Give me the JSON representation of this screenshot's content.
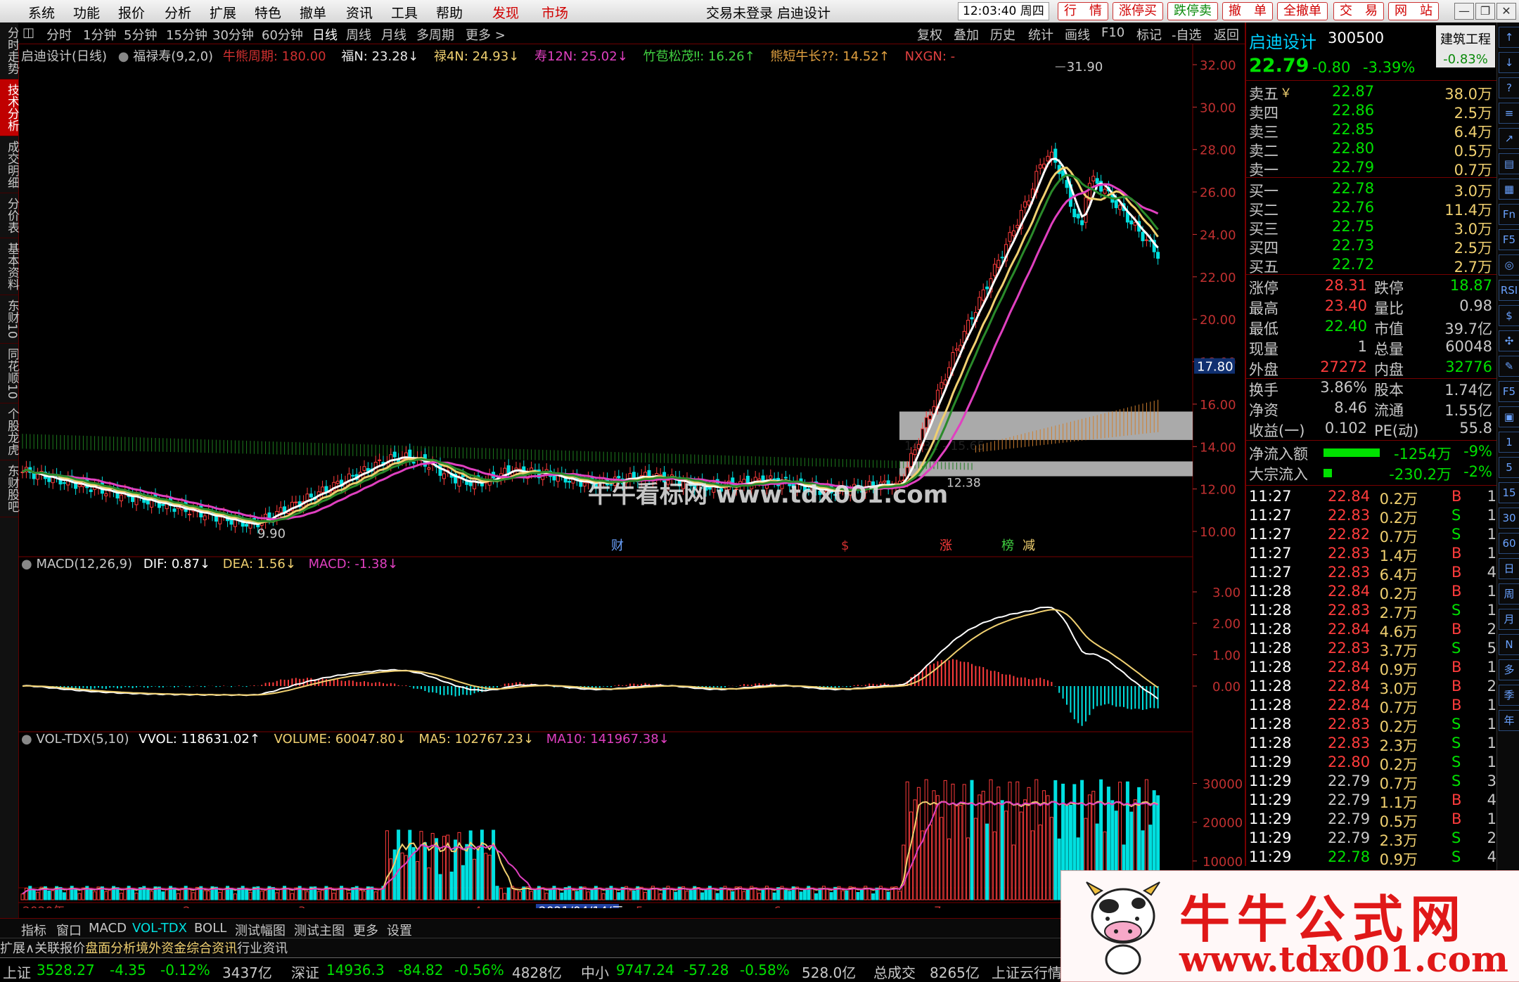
{
  "menubar": {
    "items": [
      "系统",
      "功能",
      "报价",
      "分析",
      "扩展",
      "特色",
      "撤单",
      "资讯",
      "工具",
      "帮助"
    ],
    "tabs": [
      "发现",
      "市场"
    ],
    "title": "交易未登录  启迪设计",
    "time": "12:03:40 周四",
    "pills": [
      "行　情",
      "涨停买",
      "跌停卖",
      "撤　单",
      "全撤单",
      "交　易",
      "网　站"
    ]
  },
  "left_tabs": [
    "分时走势",
    "技术分析",
    "成交明细",
    "分价表",
    "基本资料",
    "东财10",
    "同花顺10",
    "个股龙虎",
    "东财股吧"
  ],
  "toolbar": {
    "periods": [
      "分时",
      "1分钟",
      "5分钟",
      "15分钟",
      "30分钟",
      "60分钟",
      "日线",
      "周线",
      "月线",
      "多周期",
      "更多 >"
    ],
    "active_period": "日线",
    "right": [
      "复权",
      "叠加",
      "历史",
      "统计",
      "画线",
      "F10",
      "标记",
      "-自选",
      "返回"
    ]
  },
  "main_legend": {
    "name": "启迪设计(日线)",
    "indicator": "福禄寿(9,2,0)",
    "cycle": "牛熊周期: 180.00",
    "fu": "福N: 23.28↓",
    "lu": "禄4N: 24.93↓",
    "shou": "寿12N: 25.02↓",
    "zhu": "竹苞松茂‼: 16.26↑",
    "xiong": "熊短牛长??: 14.52↑",
    "nxgn": "NXGN: -"
  },
  "price_axis": [
    "32.00",
    "30.00",
    "28.00",
    "26.00",
    "24.00",
    "22.00",
    "20.00",
    "18.00",
    "16.00",
    "14.00",
    "12.00",
    "10.00"
  ],
  "price_marker": "17.80",
  "annotations": {
    "high": "31.90",
    "low": "9.90",
    "band": "14.31 - 15.65",
    "band2": "12.38"
  },
  "events": [
    "财",
    "$",
    "涨",
    "榜",
    "减"
  ],
  "macd_legend": {
    "name": "MACD(12,26,9)",
    "dif": "DIF: 0.87↓",
    "dea": "DEA: 1.56↓",
    "macd": "MACD: -1.38↓"
  },
  "macd_axis": [
    "3.00",
    "2.00",
    "1.00",
    "0.00"
  ],
  "vol_legend": {
    "name": "VOL-TDX(5,10)",
    "vvol": "VVOL: 118631.02↑",
    "volume": "VOLUME: 60047.80↓",
    "ma5": "MA5: 102767.23↓",
    "ma10": "MA10: 141967.38↓"
  },
  "vol_axis": [
    "30000",
    "20000",
    "10000"
  ],
  "date_axis": [
    "2020年",
    "2",
    "3",
    "4",
    "2021/04/14/三",
    "5",
    "6",
    "7"
  ],
  "watermark": "牛牛看标网 www.tdx001.com",
  "quote": {
    "name": "启迪设计",
    "code": "300500",
    "industry": "建筑工程",
    "price": "22.79",
    "change": "-0.80",
    "pct": "-3.39%",
    "industry_pct": "-0.83%",
    "asks": [
      {
        "label": "卖五",
        "sym": "￥",
        "price": "22.87",
        "vol": "38.0万"
      },
      {
        "label": "卖四",
        "sym": "",
        "price": "22.86",
        "vol": "2.5万"
      },
      {
        "label": "卖三",
        "sym": "",
        "price": "22.85",
        "vol": "6.4万"
      },
      {
        "label": "卖二",
        "sym": "",
        "price": "22.80",
        "vol": "0.5万"
      },
      {
        "label": "卖一",
        "sym": "",
        "price": "22.79",
        "vol": "0.7万"
      }
    ],
    "bids": [
      {
        "label": "买一",
        "price": "22.78",
        "vol": "3.0万"
      },
      {
        "label": "买二",
        "price": "22.76",
        "vol": "11.4万"
      },
      {
        "label": "买三",
        "price": "22.75",
        "vol": "3.0万"
      },
      {
        "label": "买四",
        "price": "22.73",
        "vol": "2.5万"
      },
      {
        "label": "买五",
        "price": "22.72",
        "vol": "2.7万"
      }
    ],
    "stats": [
      {
        "l1": "涨停",
        "v1": "28.31",
        "l2": "跌停",
        "v2": "18.87"
      },
      {
        "l1": "最高",
        "v1": "23.40",
        "l2": "量比",
        "v2": "0.98"
      },
      {
        "l1": "最低",
        "v1": "22.40",
        "l2": "市值",
        "v2": "39.7亿"
      },
      {
        "l1": "现量",
        "v1": "1",
        "l2": "总量",
        "v2": "60048"
      },
      {
        "l1": "外盘",
        "v1": "27272",
        "l2": "内盘",
        "v2": "32776"
      },
      {
        "l1": "换手",
        "v1": "3.86%",
        "l2": "股本",
        "v2": "1.74亿"
      },
      {
        "l1": "净资",
        "v1": "8.46",
        "l2": "流通",
        "v2": "1.55亿"
      },
      {
        "l1": "收益(一)",
        "v1": "0.102",
        "l2": "PE(动)",
        "v2": "55.8"
      }
    ],
    "flows": [
      {
        "label": "净流入额",
        "value": "-1254万",
        "pct": "-9%"
      },
      {
        "label": "大宗流入",
        "value": "-230.2万",
        "pct": "-2%"
      }
    ],
    "ticks": [
      [
        "11:27",
        "22.84",
        "0.2万",
        "B",
        "1"
      ],
      [
        "11:27",
        "22.83",
        "0.2万",
        "S",
        "1"
      ],
      [
        "11:27",
        "22.82",
        "0.7万",
        "S",
        "1"
      ],
      [
        "11:27",
        "22.83",
        "1.4万",
        "B",
        "1"
      ],
      [
        "11:27",
        "22.83",
        "6.4万",
        "B",
        "4"
      ],
      [
        "11:28",
        "22.84",
        "0.2万",
        "B",
        "1"
      ],
      [
        "11:28",
        "22.83",
        "2.7万",
        "S",
        "1"
      ],
      [
        "11:28",
        "22.84",
        "4.6万",
        "B",
        "2"
      ],
      [
        "11:28",
        "22.83",
        "3.7万",
        "S",
        "5"
      ],
      [
        "11:28",
        "22.84",
        "0.9万",
        "B",
        "1"
      ],
      [
        "11:28",
        "22.84",
        "3.0万",
        "B",
        "2"
      ],
      [
        "11:28",
        "22.84",
        "0.7万",
        "B",
        "1"
      ],
      [
        "11:28",
        "22.83",
        "0.2万",
        "S",
        "1"
      ],
      [
        "11:28",
        "22.83",
        "2.3万",
        "S",
        "1"
      ],
      [
        "11:29",
        "22.80",
        "0.2万",
        "S",
        "1"
      ],
      [
        "11:29",
        "22.79",
        "0.7万",
        "S",
        "3"
      ],
      [
        "11:29",
        "22.79",
        "1.1万",
        "B",
        "4"
      ],
      [
        "11:29",
        "22.79",
        "0.5万",
        "B",
        "1"
      ],
      [
        "11:29",
        "22.79",
        "2.3万",
        "S",
        "2"
      ],
      [
        "11:29",
        "22.78",
        "0.9万",
        "S",
        "4"
      ]
    ]
  },
  "side_buttons": [
    "↑",
    "↓",
    "?",
    "≡",
    "↗",
    "▤",
    "▦",
    "Fn",
    "F5",
    "◎",
    "RSI",
    "$",
    "✣",
    "✎",
    "F5",
    "▣",
    "1",
    "5",
    "15",
    "30",
    "60",
    "日",
    "周",
    "月",
    "N",
    "多",
    "季",
    "年"
  ],
  "bottom_tabs": [
    "指标",
    "窗口",
    "MACD",
    "VOL-TDX",
    "BOLL",
    "测试幅图",
    "测试主图",
    "更多",
    "设置"
  ],
  "bottom_tabs2": [
    "扩展∧",
    "关联报价",
    "盘面分析",
    "境外资金",
    "综合资讯",
    "行业资讯"
  ],
  "status": {
    "sh": "上证",
    "sh_val": "3528.27",
    "sh_chg": "-4.35",
    "sh_pct": "-0.12%",
    "sh_amt": "3437亿",
    "sz": "深证",
    "sz_val": "14936.3",
    "sz_chg": "-84.82",
    "sz_pct": "-0.56%",
    "sz_amt": "4828亿",
    "zx": "中小",
    "zx_val": "9747.24",
    "zx_chg": "-57.28",
    "zx_pct": "-0.58%",
    "zx_amt": "528.0亿",
    "total": "总成交",
    "total_val": "8265亿",
    "tail": "上证云行情"
  },
  "banner": {
    "title": "牛牛公式网",
    "url": "www.tdx001.com"
  },
  "colors": {
    "up": "#ff3c3c",
    "down": "#00e0e0",
    "fu": "#ffffff",
    "lu": "#f0d070",
    "shou": "#e040c0",
    "band": "#2a8a2a"
  }
}
